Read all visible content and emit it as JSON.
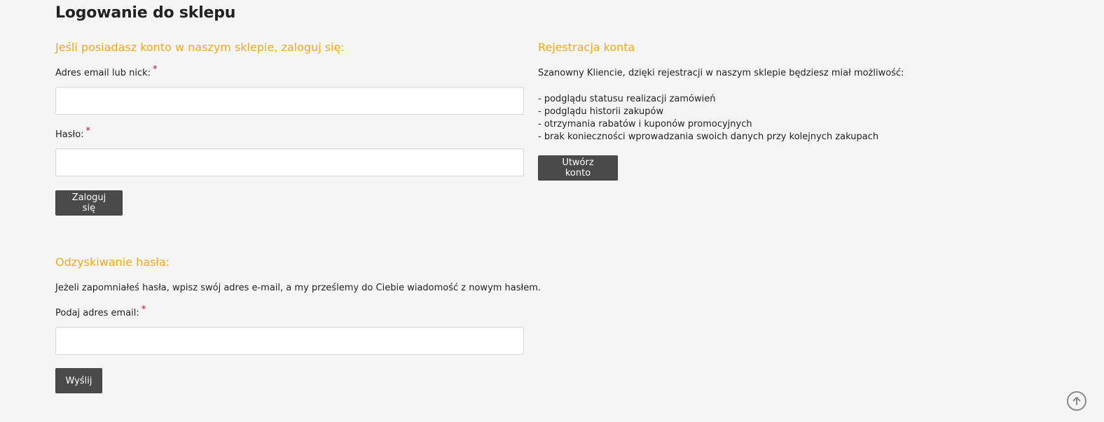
{
  "page": {
    "title": "Logowanie do sklepu"
  },
  "login": {
    "heading": "Jeśli posiadasz konto w naszym sklepie, zaloguj się:",
    "email_label": "Adres email lub nick:",
    "email_value": "",
    "password_label": "Hasło:",
    "password_value": "",
    "required_mark": "*",
    "submit_label": "Zaloguj się"
  },
  "register": {
    "heading": "Rejestracja konta",
    "intro": "Szanowny Kliencie, dzięki rejestracji w naszym sklepie będziesz miał możliwość:",
    "benefits": [
      "- podglądu statusu realizacji zamówień",
      "- podglądu historii zakupów",
      "- otrzymania rabatów i kuponów promocyjnych",
      "- brak konieczności wprowadzania swoich danych przy kolejnych zakupach"
    ],
    "button_label": "Utwórz konto"
  },
  "recovery": {
    "heading": "Odzyskiwanie hasła:",
    "description": "Jeżeli zapomniałeś hasła, wpisz swój adres e-mail, a my prześlemy do Ciebie wiadomość z nowym hasłem.",
    "email_label": "Podaj adres email:",
    "email_value": "",
    "required_mark": "*",
    "submit_label": "Wyślij"
  },
  "scroll_top": {
    "icon": "arrow-up-circle-icon"
  },
  "colors": {
    "accent": "#efa91d",
    "button_bg": "#4a4a4a",
    "required": "#d0021b",
    "page_bg": "#f5f5f5"
  }
}
